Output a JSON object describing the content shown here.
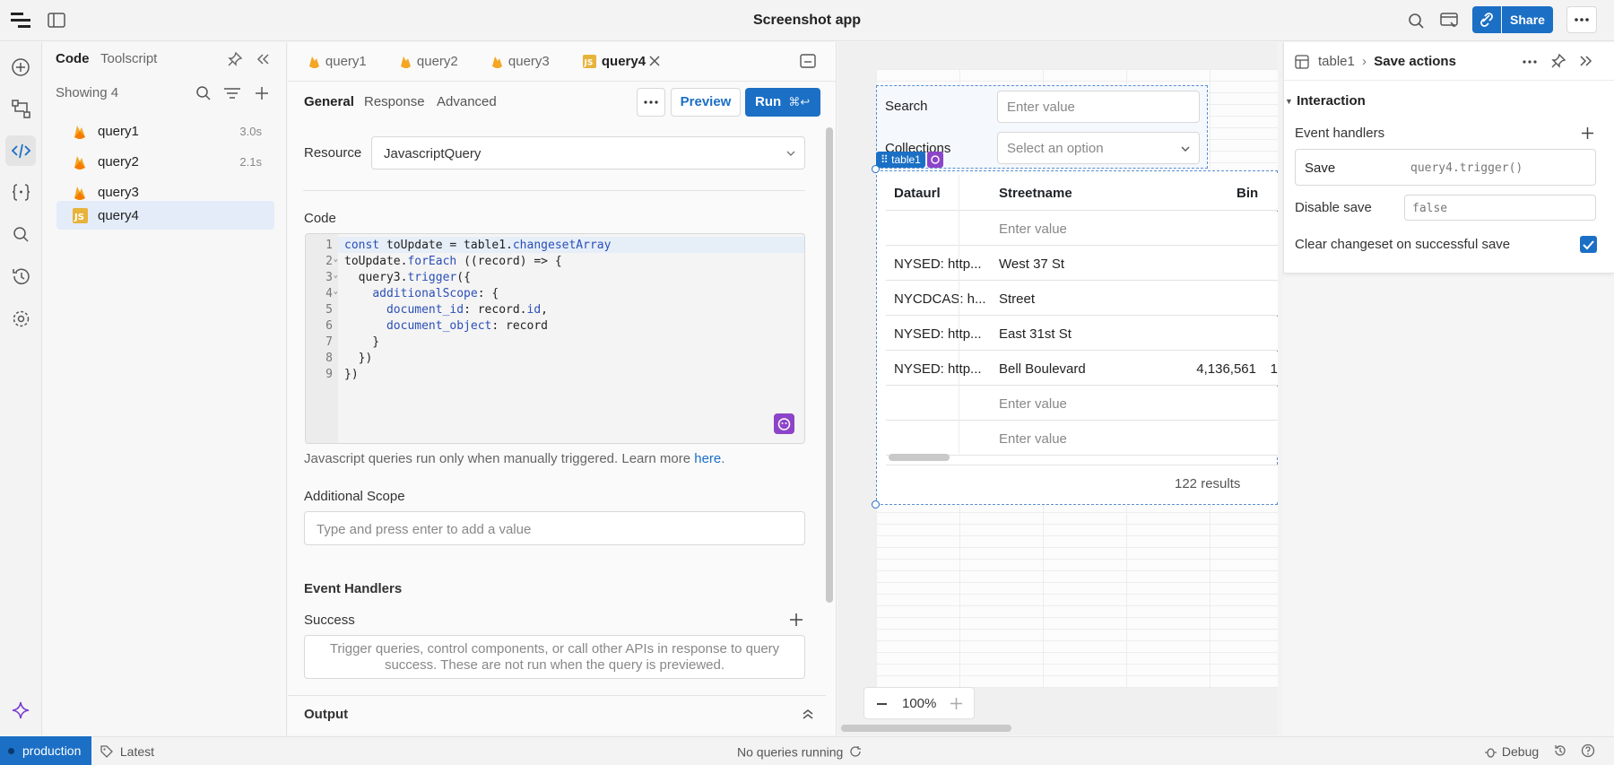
{
  "app": {
    "title": "Screenshot app",
    "share_label": "Share"
  },
  "code_panel": {
    "tabs": [
      "Code",
      "Toolscript"
    ],
    "showing": "Showing 4",
    "queries": [
      {
        "name": "query1",
        "time": "3.0s",
        "icon": "firebase-icon"
      },
      {
        "name": "query2",
        "time": "2.1s",
        "icon": "firebase-icon"
      },
      {
        "name": "query3",
        "time": "",
        "icon": "firebase-icon"
      },
      {
        "name": "query4",
        "time": "",
        "icon": "javascript-icon",
        "selected": true
      }
    ]
  },
  "editor": {
    "tabs": [
      "query1",
      "query2",
      "query3",
      "query4"
    ],
    "active_tab": "query4",
    "subtabs": [
      "General",
      "Response",
      "Advanced"
    ],
    "preview_label": "Preview",
    "run_label": "Run",
    "run_shortcut": "⌘↩",
    "resource_label": "Resource",
    "resource_value": "JavascriptQuery",
    "code_label": "Code",
    "code_lines": [
      "const toUpdate = table1.changesetArray",
      "toUpdate.forEach ((record) => {",
      "  query3.trigger({",
      "    additionalScope: {",
      "      document_id: record.id,",
      "      document_object: record",
      "    }",
      "  })",
      "})"
    ],
    "js_note": "Javascript queries run only when manually triggered. Learn more",
    "js_note_link": "here",
    "additional_scope_label": "Additional Scope",
    "additional_scope_placeholder": "Type and press enter to add a value",
    "event_handlers_label": "Event Handlers",
    "success_label": "Success",
    "success_hint": "Trigger queries, control components, or call other APIs in response to query success. These are not run when the query is previewed.",
    "output_label": "Output"
  },
  "canvas": {
    "search_label": "Search",
    "search_placeholder": "Enter value",
    "collections_label": "Collections",
    "collections_placeholder": "Select an option",
    "table_tag": "table1",
    "columns": [
      "Dataurl",
      "Streetname",
      "Bin"
    ],
    "rows": [
      {
        "dataurl": "",
        "streetname": "Enter value",
        "bin": "",
        "placeholder": true
      },
      {
        "dataurl": "NYSED: http...",
        "streetname": "West 37 St",
        "bin": ""
      },
      {
        "dataurl": "NYCDCAS: h...",
        "streetname": "Street",
        "bin": ""
      },
      {
        "dataurl": "NYSED: http...",
        "streetname": "East 31st St",
        "bin": ""
      },
      {
        "dataurl": "NYSED: http...",
        "streetname": "Bell Boulevard",
        "bin": "4,136,561",
        "extra": "1"
      },
      {
        "dataurl": "",
        "streetname": "Enter value",
        "bin": "",
        "placeholder": true
      },
      {
        "dataurl": "",
        "streetname": "Enter value",
        "bin": "",
        "placeholder": true
      }
    ],
    "results": "122 results",
    "zoom": "100%"
  },
  "inspector": {
    "breadcrumb_parent": "table1",
    "breadcrumb_current": "Save actions",
    "section": "Interaction",
    "event_handlers_label": "Event handlers",
    "handler_event": "Save",
    "handler_action": "query4.trigger()",
    "disable_save_label": "Disable save",
    "disable_save_value": "false",
    "clear_changeset_label": "Clear changeset on successful save",
    "clear_changeset_checked": true
  },
  "footer": {
    "environment": "production",
    "version": "Latest",
    "status": "No queries running",
    "debug_label": "Debug"
  },
  "colors": {
    "accent": "#1b6fc5",
    "selection": "#e3ecf8"
  }
}
